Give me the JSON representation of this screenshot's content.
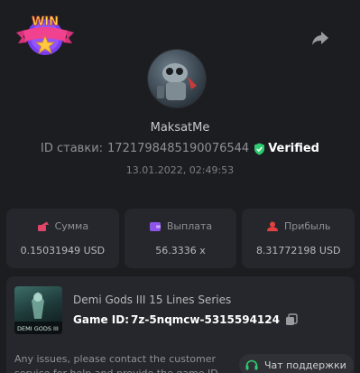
{
  "header": {
    "win_badge_text": "WIN",
    "share_icon": "share-icon"
  },
  "profile": {
    "username": "MaksatMe",
    "bet_id_label": "ID ставки:",
    "bet_id": "1721798485190076544",
    "verified_label": "Verified",
    "date": "13.01.2022, 02:49:53"
  },
  "stats": [
    {
      "label": "Сумма",
      "value": "0.15031949 USD",
      "icon": "coins-icon",
      "color": "#e2456a"
    },
    {
      "label": "Выплата",
      "value": "56.3336 x",
      "icon": "wallet-icon",
      "color": "#8d54e8"
    },
    {
      "label": "Прибыль",
      "value": "8.31772198 USD",
      "icon": "profit-icon",
      "color": "#e54040"
    }
  ],
  "game": {
    "title": "Demi Gods III 15 Lines Series",
    "id_label": "Game ID:",
    "id_value": "7z-5nqmcw-5315594124",
    "thumb_text": "DEMI GODS III"
  },
  "support": {
    "issue_text": "Any issues, please contact the customer service for help and provide the game ID",
    "chat_label": "Чат поддержки"
  },
  "colors": {
    "background": "#1c1d21",
    "card": "#26272c",
    "verified_green": "#2ecc71"
  }
}
